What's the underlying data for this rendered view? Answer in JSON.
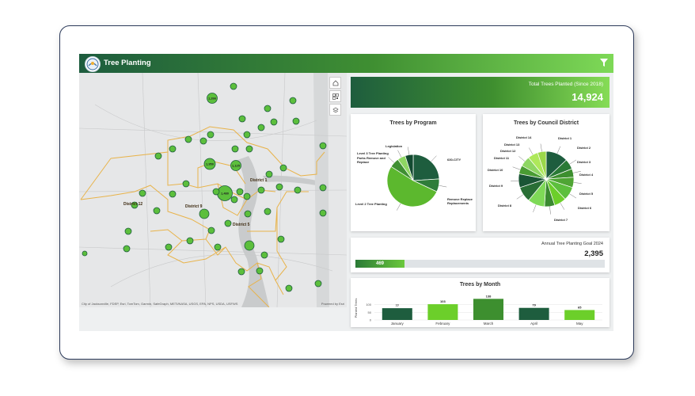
{
  "app": {
    "title": "Tree Planting"
  },
  "map": {
    "attribution": "City of Jacksonville, FDEP, Esri, TomTom, Garmin, SafeGraph, METI/NASA, USGS, EPA, NPS, USDA, USFWS",
    "powered_by": "Powered by Esri",
    "district_labels": [
      "District 1",
      "District 12",
      "District 9",
      "District 5"
    ],
    "cluster_labels": [
      "1,266",
      "1,480",
      "1,125",
      "1,950"
    ]
  },
  "total": {
    "label": "Total Trees Planted (Since 2018)",
    "value": "14,924"
  },
  "program_chart": {
    "title": "Trees by Program",
    "labels": [
      "Legislation",
      "Level 3 Tree Planting",
      "Parks Remove and Replace",
      "630-CITY",
      "Remove Replace Replacements",
      "Level 2 Tree Planting"
    ]
  },
  "district_chart": {
    "title": "Trees by Council District",
    "labels": [
      "District 14",
      "District 13",
      "District 12",
      "District 11",
      "District 10",
      "District 1",
      "District 2",
      "District 3",
      "District 4",
      "District 5",
      "District 6",
      "District 7",
      "District 8",
      "District 9"
    ]
  },
  "goal": {
    "label": "Annual Tree Planting Goal 2024",
    "value": "2,395",
    "progress_value": "469",
    "progress_fraction": 0.196
  },
  "chart_data": [
    {
      "type": "pie",
      "title": "Trees by Program",
      "categories": [
        "630-CITY",
        "Remove Replace Replacements",
        "Level 2 Tree Planting",
        "Parks Remove and Replace",
        "Level 3 Tree Planting",
        "Legislation"
      ],
      "values": [
        24,
        8,
        52,
        6,
        5,
        5
      ]
    },
    {
      "type": "pie",
      "title": "Trees by Council District",
      "categories": [
        "District 1",
        "District 2",
        "District 3",
        "District 4",
        "District 5",
        "District 6",
        "District 7",
        "District 8",
        "District 9",
        "District 10",
        "District 11",
        "District 12",
        "District 13",
        "District 14"
      ],
      "values": [
        13,
        6,
        5,
        6,
        8,
        7,
        6,
        10,
        9,
        8,
        5,
        6,
        6,
        5
      ]
    },
    {
      "type": "bar",
      "title": "Trees by Month",
      "categories": [
        "January",
        "February",
        "March",
        "April",
        "May"
      ],
      "values": [
        77,
        103,
        138,
        79,
        65
      ],
      "ylabel": "Planted Trees",
      "yticks": [
        "100",
        "50",
        "0"
      ],
      "ylim": [
        0,
        150
      ],
      "colors": [
        "#1e5d3e",
        "#6ccf2a",
        "#3d8f2f",
        "#1e5d3e",
        "#6ccf2a"
      ]
    }
  ],
  "colors": {
    "dark_green": "#1e5d3e",
    "mid_green": "#3f8f32",
    "light_green": "#7ed957",
    "district_line": "#e8b34a"
  }
}
